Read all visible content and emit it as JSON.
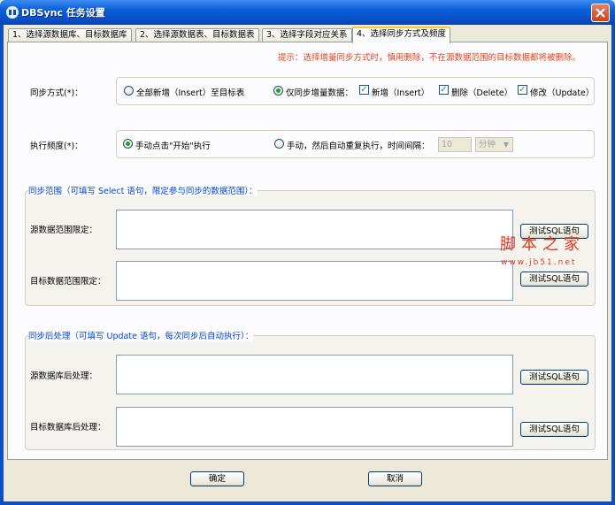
{
  "window": {
    "title": "DBSync 任务设置"
  },
  "tabs": [
    "1、选择源数据库、目标数据库",
    "2、选择源数据表、目标数据表",
    "3、选择字段对应关系",
    "4、选择同步方式及频度"
  ],
  "hint": "提示：选择增量同步方式时，慎用删除，不在源数据范围的目标数据都将被删除。",
  "sync_mode": {
    "label": "同步方式(*)：",
    "full": "全部新增（Insert）至目标表",
    "incremental": "仅同步增量数据：",
    "insert": "新增（Insert）",
    "delete": "删除（Delete）",
    "update": "修改（Update）"
  },
  "frequency": {
    "label": "执行频度(*)：",
    "manual": "手动点击\"开始\"执行",
    "auto": "手动，然后自动重复执行，时间间隔：",
    "interval_value": "10",
    "interval_unit": "分钟"
  },
  "scope": {
    "title": "同步范围（可填写 Select 语句，限定参与同步的数据范围）：",
    "source_label": "源数据范围限定：",
    "target_label": "目标数据范围限定：",
    "test_button": "测试SQL语句"
  },
  "post": {
    "title": "同步后处理（可填写 Update 语句，每次同步后自动执行）：",
    "source_label": "源数据库后处理：",
    "target_label": "目标数据库后处理：",
    "test_button": "测试SQL语句"
  },
  "buttons": {
    "ok": "确定",
    "cancel": "取消"
  },
  "watermark": {
    "text": "脚本之家",
    "url": "www.jb51.net"
  }
}
